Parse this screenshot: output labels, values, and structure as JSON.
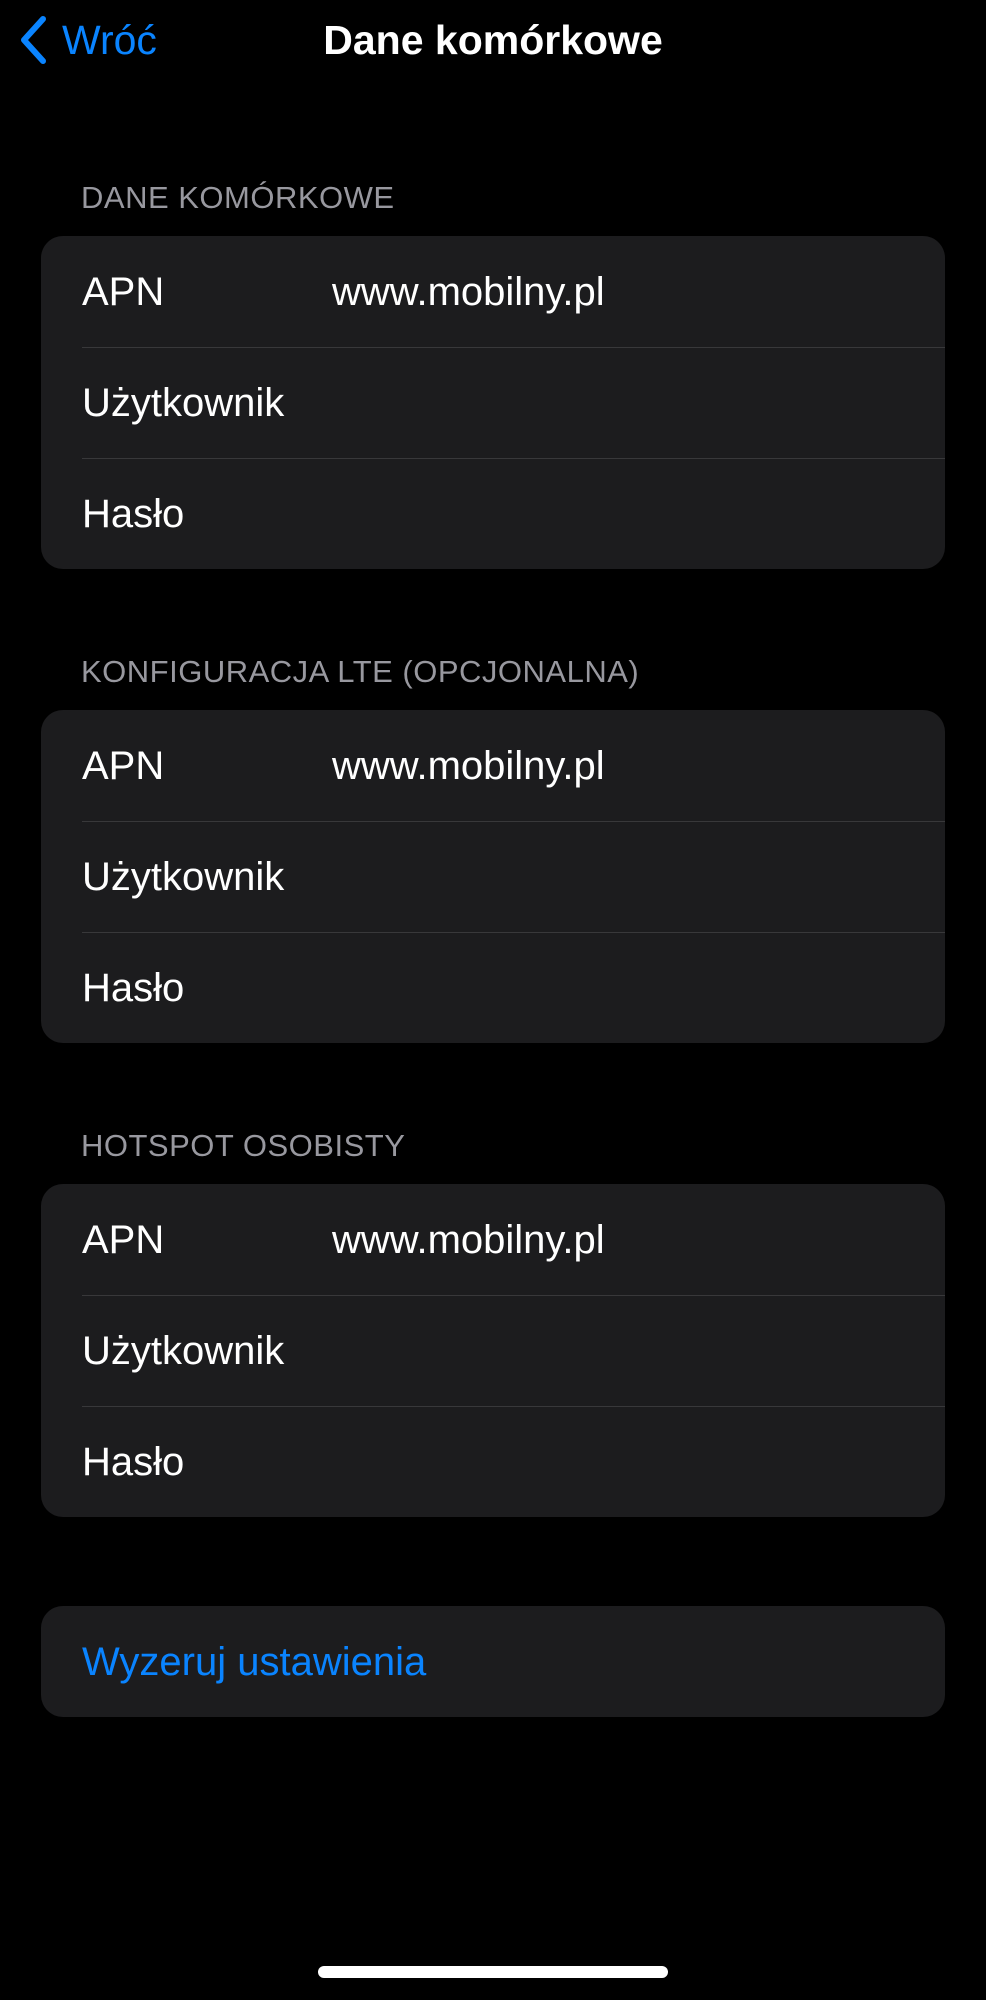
{
  "nav": {
    "back_label": "Wróć",
    "back_icon": "chevron-left-icon",
    "title": "Dane komórkowe"
  },
  "sections": [
    {
      "header": "DANE KOMÓRKOWE",
      "rows": [
        {
          "label": "APN",
          "value": "www.mobilny.pl"
        },
        {
          "label": "Użytkownik",
          "value": ""
        },
        {
          "label": "Hasło",
          "value": ""
        }
      ]
    },
    {
      "header": "KONFIGURACJA LTE (OPCJONALNA)",
      "rows": [
        {
          "label": "APN",
          "value": "www.mobilny.pl"
        },
        {
          "label": "Użytkownik",
          "value": ""
        },
        {
          "label": "Hasło",
          "value": ""
        }
      ]
    },
    {
      "header": "HOTSPOT OSOBISTY",
      "rows": [
        {
          "label": "APN",
          "value": "www.mobilny.pl"
        },
        {
          "label": "Użytkownik",
          "value": ""
        },
        {
          "label": "Hasło",
          "value": ""
        }
      ]
    }
  ],
  "reset": {
    "label": "Wyzeruj ustawienia"
  },
  "colors": {
    "background": "#000000",
    "group_background": "#1c1c1e",
    "accent": "#0a84ff",
    "header_text": "#98989f",
    "separator": "#38383a"
  }
}
